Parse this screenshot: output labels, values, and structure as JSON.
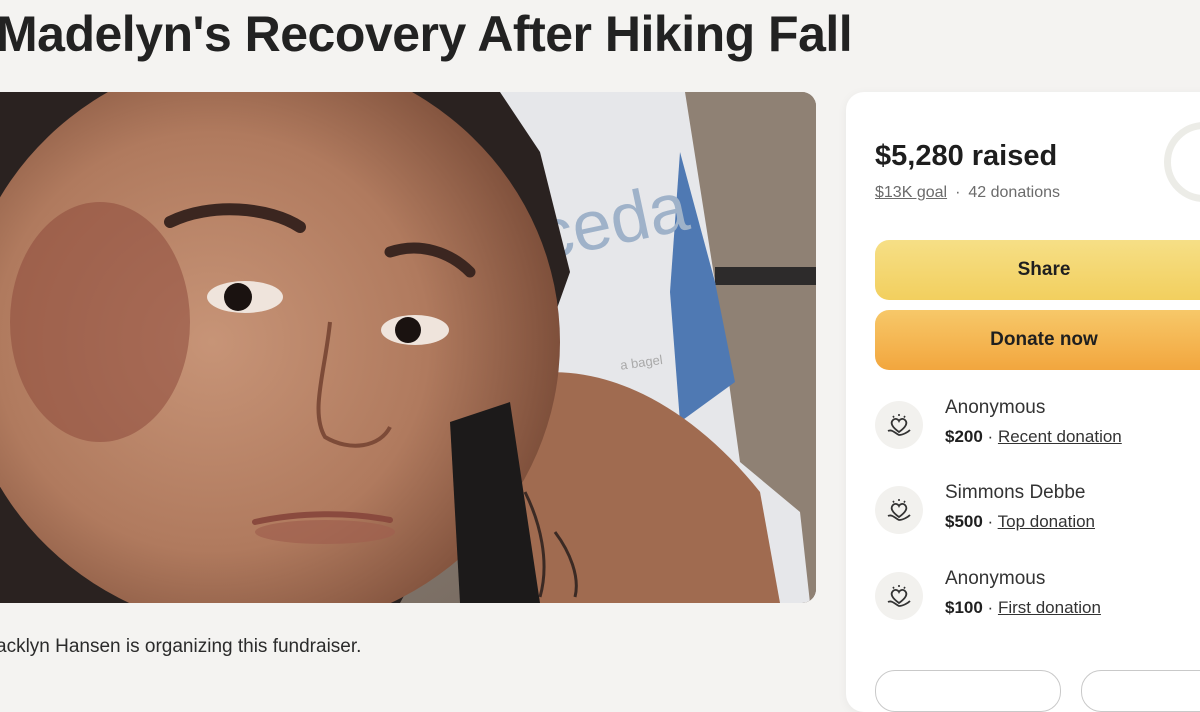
{
  "page": {
    "title": "Madelyn's Recovery After Hiking Fall",
    "organizer_text": "acklyn Hansen is organizing this fundraiser."
  },
  "photo": {
    "bag_text": "ceda",
    "bag_small_text": "a bagel"
  },
  "progress": {
    "raised": "$5,280 raised",
    "goal": "$13K goal",
    "separator": "·",
    "donations_count": "42 donations"
  },
  "actions": {
    "share_label": "Share",
    "donate_label": "Donate now"
  },
  "donations": [
    {
      "name": "Anonymous",
      "amount": "$200",
      "sep": " · ",
      "label": "Recent donation"
    },
    {
      "name": "Simmons Debbe",
      "amount": "$500",
      "sep": " · ",
      "label": "Top donation"
    },
    {
      "name": "Anonymous",
      "amount": "$100",
      "sep": " · ",
      "label": "First donation"
    }
  ],
  "colors": {
    "share_button": "#f2cf5e",
    "donate_button": "#f2a63e",
    "background": "#f4f3f1"
  },
  "icons": {
    "donor_icon": "heart-hand-icon"
  }
}
